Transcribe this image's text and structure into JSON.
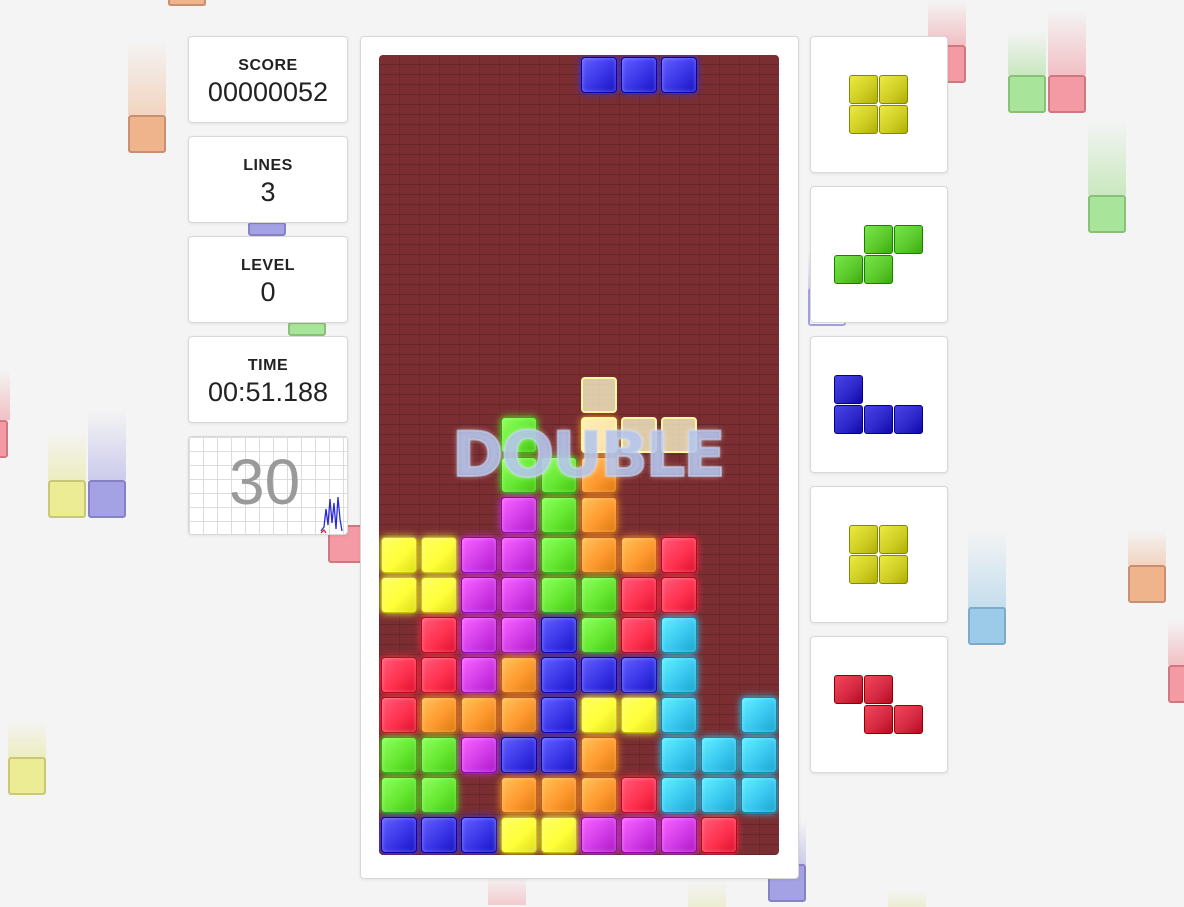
{
  "stats": {
    "score": {
      "label": "SCORE",
      "value": "00000052"
    },
    "lines": {
      "label": "LINES",
      "value": "3"
    },
    "level": {
      "label": "LEVEL",
      "value": "0"
    },
    "time": {
      "label": "TIME",
      "value": "00:51.188"
    }
  },
  "fps": {
    "value": "30"
  },
  "banner": {
    "text": "DOUBLE"
  },
  "colors": {
    "Y": "#ffff3a",
    "G": "#66e832",
    "M": "#d23ce8",
    "O": "#ff9a30",
    "R": "#ff3250",
    "B": "#3a36e8",
    "C": "#3ac8f0"
  },
  "board": {
    "columns": 10,
    "rows": 20,
    "active_piece": {
      "color": "B",
      "cells": [
        [
          5,
          0
        ],
        [
          6,
          0
        ],
        [
          7,
          0
        ]
      ]
    },
    "ghost_cells": [
      [
        5,
        8
      ],
      [
        5,
        9
      ],
      [
        6,
        9
      ],
      [
        7,
        9
      ]
    ],
    "grid": [
      "..........",
      "..........",
      "..........",
      "..........",
      "..........",
      "..........",
      "..........",
      "..........",
      "..........",
      "...G.O....",
      "...GGO....",
      "...MGO....",
      "YYMMGOOR..",
      "YYMMGGRR..",
      ".RMMBGRC..",
      "RRMOBBBC..",
      "ROOOBYYC.C",
      "GGMBBO.CCC",
      "GG.OOORCCC",
      "BBBYYMMMR."
    ]
  },
  "next_pieces": [
    {
      "name": "O",
      "color": "#cccc22",
      "cells": [
        [
          0,
          0
        ],
        [
          1,
          0
        ],
        [
          0,
          1
        ],
        [
          1,
          1
        ]
      ]
    },
    {
      "name": "S",
      "color": "#5ac82a",
      "cells": [
        [
          1,
          0
        ],
        [
          2,
          0
        ],
        [
          0,
          1
        ],
        [
          1,
          1
        ]
      ]
    },
    {
      "name": "J",
      "color": "#2c26c8",
      "cells": [
        [
          0,
          0
        ],
        [
          0,
          1
        ],
        [
          1,
          1
        ],
        [
          2,
          1
        ]
      ]
    },
    {
      "name": "O",
      "color": "#cccc22",
      "cells": [
        [
          0,
          0
        ],
        [
          1,
          0
        ],
        [
          0,
          1
        ],
        [
          1,
          1
        ]
      ]
    },
    {
      "name": "Z",
      "color": "#d42840",
      "cells": [
        [
          0,
          0
        ],
        [
          1,
          0
        ],
        [
          1,
          1
        ],
        [
          2,
          1
        ]
      ]
    }
  ]
}
